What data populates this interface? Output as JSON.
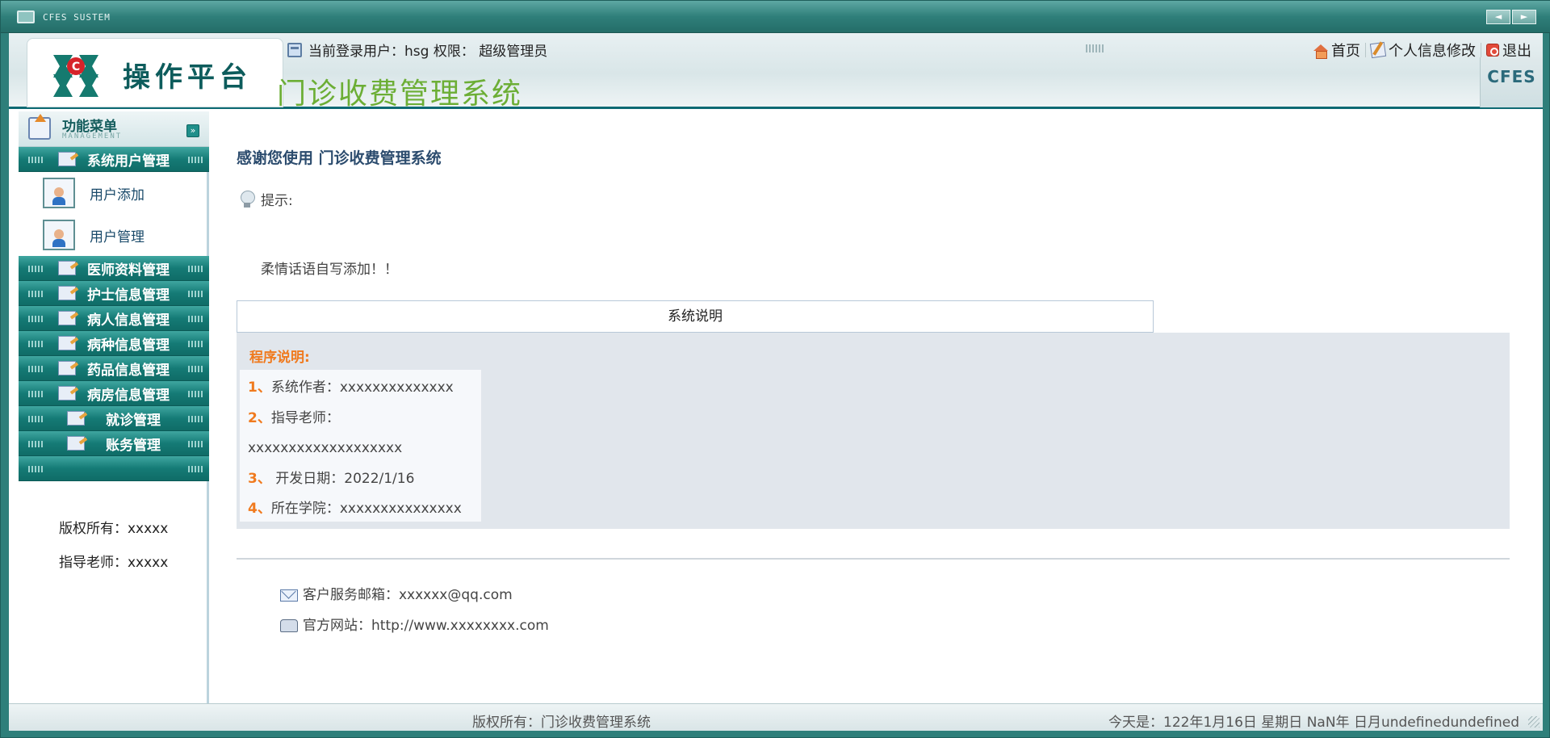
{
  "window": {
    "title": "CFES SUSTEM",
    "prev_label": "◄",
    "next_label": "►"
  },
  "header": {
    "logo_text": "操作平台",
    "system_title": "门诊收费管理系统",
    "login_info": "当前登录用户：hsg 权限： 超级管理员",
    "links": {
      "home": "首页",
      "profile": "个人信息修改",
      "logout": "退出"
    },
    "badge": "CFES"
  },
  "sidebar": {
    "menu_title": "功能菜单",
    "menu_subtitle": "MANAGEMENT",
    "groups": [
      {
        "label": "系统用户管理"
      },
      {
        "label": "医师资料管理"
      },
      {
        "label": "护士信息管理"
      },
      {
        "label": "病人信息管理"
      },
      {
        "label": "病种信息管理"
      },
      {
        "label": "药品信息管理"
      },
      {
        "label": "病房信息管理"
      },
      {
        "label": "就诊管理"
      },
      {
        "label": "账务管理"
      }
    ],
    "sub_items": [
      {
        "label": "用户添加"
      },
      {
        "label": "用户管理"
      }
    ],
    "copyright": "版权所有：xxxxx",
    "teacher": "指导老师：xxxxx"
  },
  "main": {
    "welcome": "感谢您使用 门诊收费管理系统",
    "tip_label": "提示:",
    "tip_message": "柔情话语自写添加！！",
    "sysbox_title": "系统说明",
    "program_title": "程序说明:",
    "info": [
      {
        "num": "1、",
        "text": "系统作者：xxxxxxxxxxxxxx"
      },
      {
        "num": "2、",
        "text": "指导老师："
      },
      {
        "num": "",
        "text": "xxxxxxxxxxxxxxxxxxx"
      },
      {
        "num": "3、",
        "text": " 开发日期：2022/1/16"
      },
      {
        "num": "4、",
        "text": "所在学院：xxxxxxxxxxxxxxx"
      }
    ],
    "email": "客户服务邮箱：xxxxxx@qq.com",
    "website": "官方网站：http://www.xxxxxxxx.com"
  },
  "status": {
    "copyright": "版权所有：门诊收费管理系统",
    "today": "今天是：122年1月16日 星期日 NaN年 日月undefinedundefined"
  }
}
